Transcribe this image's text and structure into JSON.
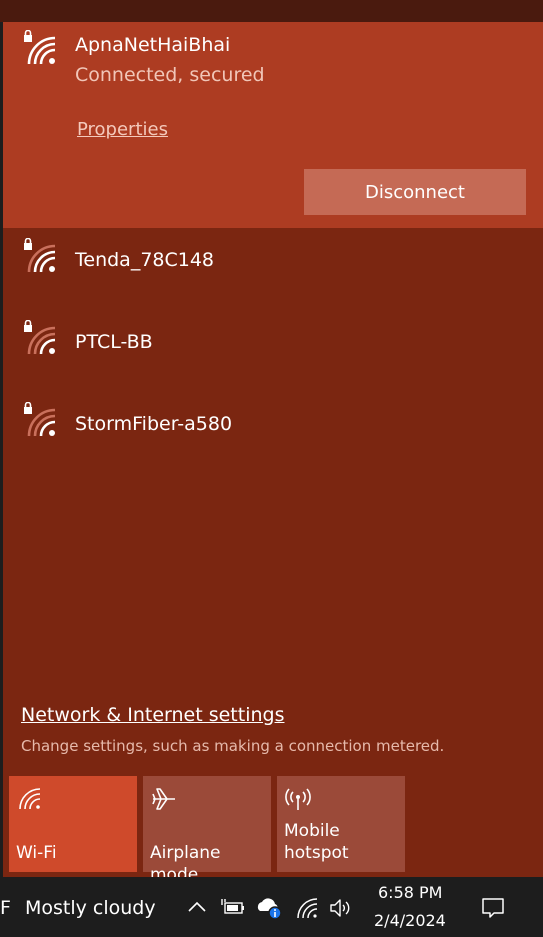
{
  "connected_network": {
    "name": "ApnaNetHaiBhai",
    "status": "Connected, secured",
    "properties_label": "Properties",
    "disconnect_label": "Disconnect"
  },
  "networks": [
    {
      "name": "Tenda_78C148",
      "secured": true
    },
    {
      "name": "PTCL-BB",
      "secured": true
    },
    {
      "name": "StormFiber-a580",
      "secured": true
    }
  ],
  "settings": {
    "link_label": "Network & Internet settings",
    "description": "Change settings, such as making a connection metered."
  },
  "quick_actions": [
    {
      "label": "Wi-Fi",
      "icon": "wifi-icon",
      "active": true
    },
    {
      "label": "Airplane mode",
      "icon": "airplane-icon",
      "active": false
    },
    {
      "label": "Mobile\nhotspot",
      "icon": "hotspot-icon",
      "active": false
    }
  ],
  "taskbar": {
    "weather_partial_char": "F",
    "weather_text": "Mostly cloudy",
    "time": "6:58 PM",
    "date": "2/4/2024"
  },
  "colors": {
    "connected_bg": "#ad3c22",
    "flyout_bg": "#7b2611",
    "active_tile": "#cf4a2b",
    "inactive_tile": "#9b4a39",
    "taskbar_bg": "#1d1d1d"
  }
}
